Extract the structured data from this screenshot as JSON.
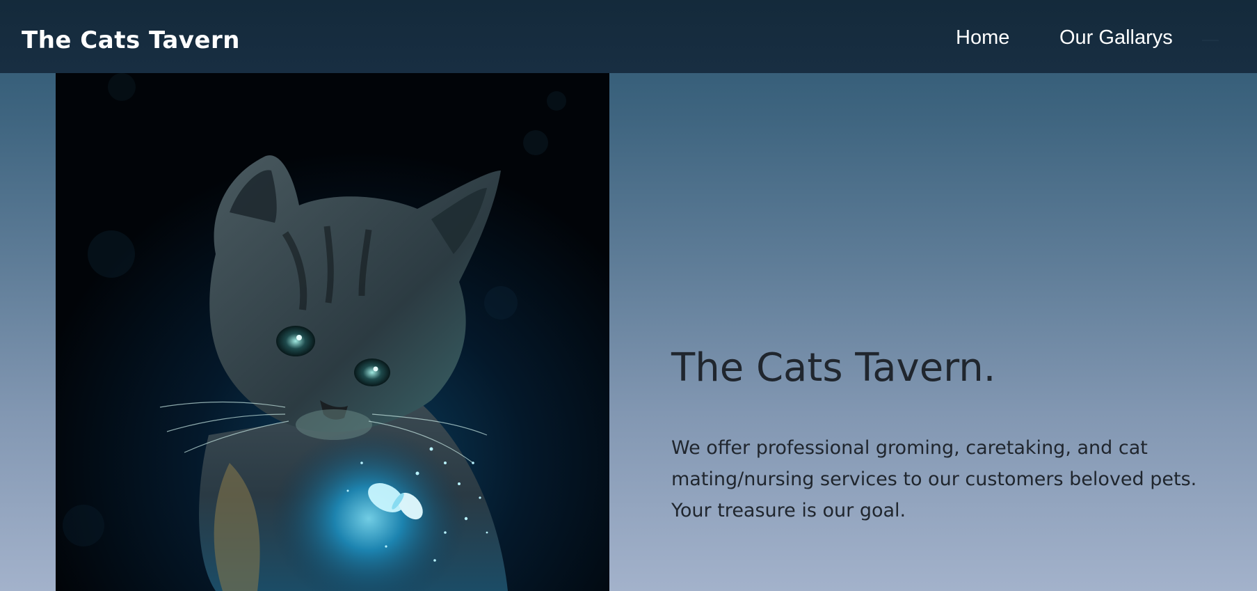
{
  "navbar": {
    "brand": "The Cats Tavern",
    "links": [
      {
        "label": "Home"
      },
      {
        "label": "Our Gallarys"
      }
    ]
  },
  "hero": {
    "image_alt": "kitten with glowing butterfly",
    "title": "The Cats Tavern.",
    "description": "We offer professional groming, caretaking, and cat mating/nursing services to our customers beloved pets. Your treasure is our goal."
  },
  "colors": {
    "navbar_bg": "#162c3f",
    "text_dark": "#20262e",
    "gradient_top": "#2b5670",
    "gradient_bottom": "#a3b2cb"
  }
}
